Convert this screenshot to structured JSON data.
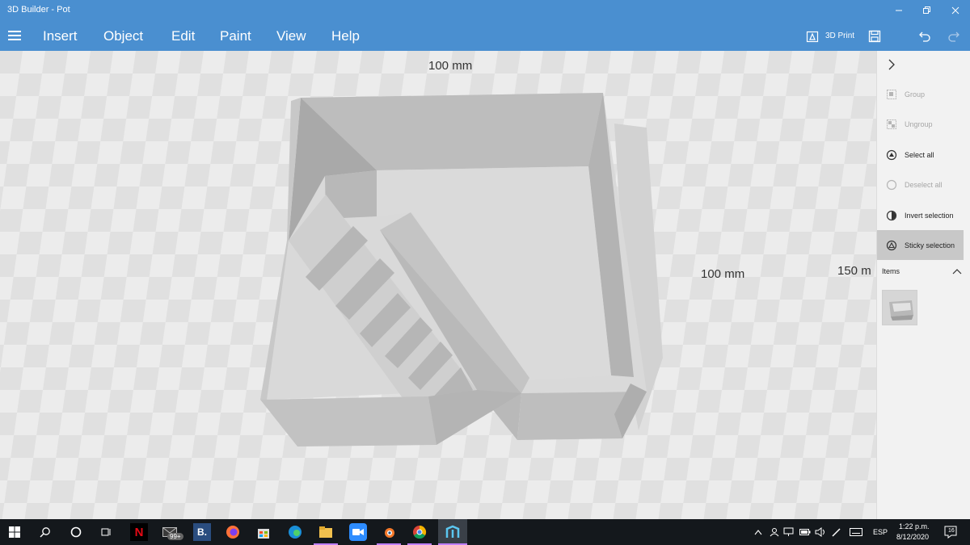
{
  "window": {
    "title": "3D Builder - Pot",
    "minimize_icon": "minimize-icon",
    "maximize_icon": "restore-icon",
    "close_icon": "close-icon"
  },
  "menu": {
    "hamburger_icon": "hamburger-icon",
    "items": [
      "Insert",
      "Object",
      "Edit",
      "Paint",
      "View",
      "Help"
    ],
    "print_label": "3D Print",
    "save_icon": "save-icon",
    "undo_icon": "undo-icon",
    "redo_icon": "redo-icon"
  },
  "viewport": {
    "dim_top": "100 mm",
    "dim_right": "100 mm",
    "dim_far": "150 m",
    "model_color": "#c6c6c6"
  },
  "panel": {
    "collapse_icon": "chevron-right-icon",
    "actions": [
      {
        "label": "Group",
        "enabled": false,
        "active": false
      },
      {
        "label": "Ungroup",
        "enabled": false,
        "active": false
      },
      {
        "label": "Select all",
        "enabled": true,
        "active": false
      },
      {
        "label": "Deselect all",
        "enabled": false,
        "active": false
      },
      {
        "label": "Invert selection",
        "enabled": true,
        "active": false
      },
      {
        "label": "Sticky selection",
        "enabled": true,
        "active": true
      }
    ],
    "items_label": "Items"
  },
  "taskbar": {
    "mail_badge": "99+",
    "bing_label": "B.",
    "language": "ESP",
    "time": "1:22 p.m.",
    "date": "8/12/2020",
    "notifications": "16"
  },
  "colors": {
    "accent": "#4a8fd0",
    "taskbar": "#14181c",
    "panel_active": "#c8c8c8"
  }
}
